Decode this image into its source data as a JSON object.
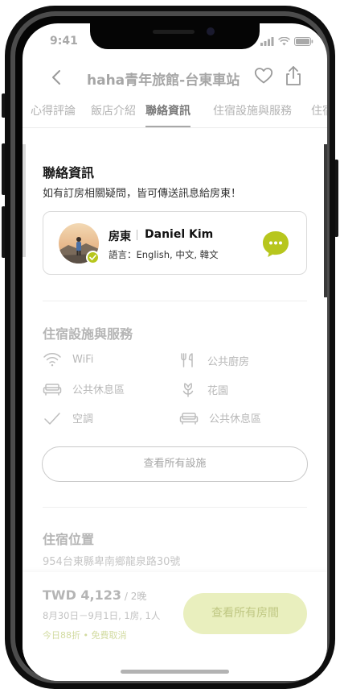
{
  "status_bar": {
    "time": "9:41"
  },
  "header": {
    "title": "haha青年旅館-台東車站"
  },
  "tabs": [
    {
      "label": "心得評論"
    },
    {
      "label": "飯店介紹"
    },
    {
      "label": "聯絡資訊",
      "active": true
    },
    {
      "label": "住宿設施與服務"
    },
    {
      "label": "住宿位置"
    }
  ],
  "contact": {
    "title": "聯絡資訊",
    "description": "如有訂房相關疑問，皆可傳送訊息給房東！",
    "host": {
      "role": "房東",
      "name": "Daniel Kim",
      "languages": "語言：English, 中文, 韓文",
      "chat_icon": "chat-bubble-icon"
    }
  },
  "facilities": {
    "title": "住宿設施與服務",
    "items": [
      {
        "label": "WiFi",
        "icon": "wifi-icon"
      },
      {
        "label": "公共廚房",
        "icon": "kitchen-utensils-icon"
      },
      {
        "label": "公共休息區",
        "icon": "sofa-icon"
      },
      {
        "label": "花園",
        "icon": "flower-icon"
      },
      {
        "label": "空調",
        "icon": "checkmark-icon"
      },
      {
        "label": "公共休息區",
        "icon": "sofa-icon"
      }
    ],
    "view_all_label": "查看所有設施"
  },
  "location": {
    "title": "住宿位置",
    "address": "954台東縣卑南鄉龍泉路30號"
  },
  "booking": {
    "price": "TWD 4,123",
    "unit": " / 2晚",
    "dates": "8月30日－9月1日, 1房, 1人",
    "promo": "今日88折 • 免費取消",
    "button_label": "查看所有房間"
  },
  "colors": {
    "accent": "#b7c61d",
    "button_disabled_bg": "#e9efbe",
    "text_primary": "#1a1a1a",
    "text_muted": "#b5b5b5"
  }
}
